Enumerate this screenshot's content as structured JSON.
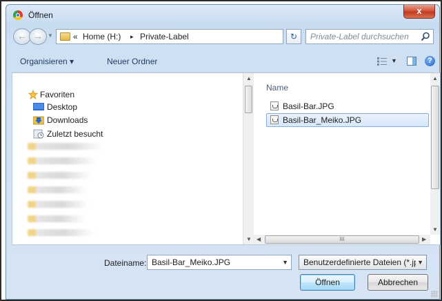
{
  "window": {
    "title": "Öffnen",
    "close_glyph": "x"
  },
  "nav": {
    "back_glyph": "←",
    "forward_glyph": "→",
    "breadcrumb": {
      "overflow": "«",
      "root": "Home (H:)",
      "sep": "▸",
      "current": "Private-Label"
    },
    "refresh_glyph": "↻",
    "search_placeholder": "Private-Label durchsuchen"
  },
  "toolbar": {
    "organize": "Organisieren ▾",
    "new_folder": "Neuer Ordner",
    "help_glyph": "?"
  },
  "sidebar": {
    "items": [
      {
        "label": "Favoriten",
        "icon": "star-icon"
      },
      {
        "label": "Desktop",
        "icon": "desktop-icon"
      },
      {
        "label": "Downloads",
        "icon": "downloads-icon"
      },
      {
        "label": "Zuletzt besucht",
        "icon": "recent-places-icon"
      }
    ]
  },
  "file_list": {
    "column_name": "Name",
    "files": [
      {
        "label": "Basil-Bar.JPG",
        "selected": false
      },
      {
        "label": "Basil-Bar_Meiko.JPG",
        "selected": true
      }
    ],
    "hscroll_thumb_glyph": "III"
  },
  "footer": {
    "filename_label": "Dateiname:",
    "filename_value": "Basil-Bar_Meiko.JPG",
    "filetype_value": "Benutzerdefinierte Dateien (*.jp",
    "open_button": "Öffnen",
    "cancel_button": "Abbrechen"
  },
  "colors": {
    "selection_border": "#84acdd",
    "close_red": "#c23b22",
    "frame": "#dbe8f6"
  }
}
